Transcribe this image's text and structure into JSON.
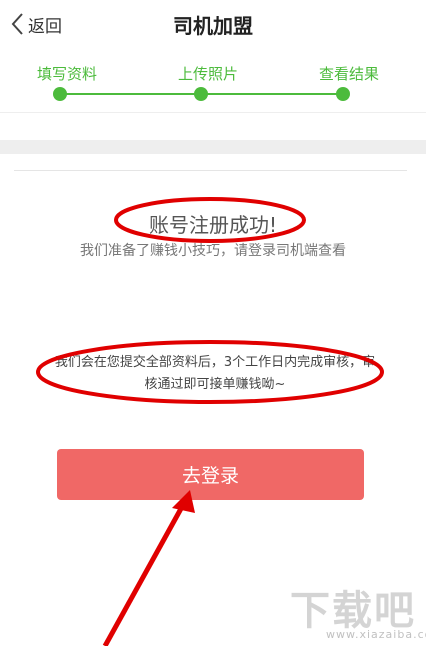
{
  "header": {
    "back_label": "返回",
    "title": "司机加盟"
  },
  "steps": [
    {
      "label": "填写资料"
    },
    {
      "label": "上传照片"
    },
    {
      "label": "查看结果"
    }
  ],
  "result": {
    "success_text": "账号注册成功!",
    "tip_text": "我们准备了赚钱小技巧，请登录司机端查看",
    "notice_text": "我们会在您提交全部资料后，3个工作日内完成审核，审核通过即可接单赚钱呦~"
  },
  "login_button": {
    "label": "去登录"
  },
  "watermark": {
    "logo_text": "下载吧",
    "url_text": "www.xiazaiba.com"
  },
  "colors": {
    "step_green": "#4cbb3c",
    "button_red": "#f06866",
    "annotation_red": "#e00000"
  }
}
